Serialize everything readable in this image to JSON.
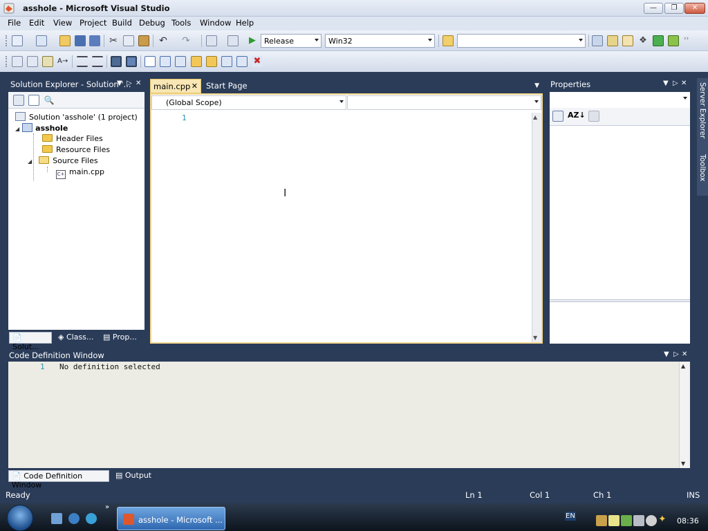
{
  "window": {
    "title": "asshole - Microsoft Visual Studio"
  },
  "menu": [
    "File",
    "Edit",
    "View",
    "Project",
    "Build",
    "Debug",
    "Tools",
    "Window",
    "Help"
  ],
  "toolbar": {
    "config": "Release",
    "platform": "Win32",
    "find_value": ""
  },
  "solution_explorer": {
    "title": "Solution Explorer - Solution '...",
    "solution": "Solution 'asshole' (1 project)",
    "project": "asshole",
    "folders": [
      "Header Files",
      "Resource Files",
      "Source Files"
    ],
    "file": "main.cpp",
    "tabs": [
      "Solut...",
      "Class...",
      "Prop..."
    ]
  },
  "editor": {
    "tabs": [
      "main.cpp",
      "Start Page"
    ],
    "scope": "(Global Scope)",
    "member": "",
    "line_number": "1"
  },
  "properties": {
    "title": "Properties",
    "selector": ""
  },
  "code_definition": {
    "title": "Code Definition Window",
    "line_number": "1",
    "text": "No definition selected",
    "tabs": [
      "Code Definition Window",
      "Output"
    ]
  },
  "side_tabs": [
    "Server Explorer",
    "Toolbox"
  ],
  "status": {
    "ready": "Ready",
    "ln": "Ln 1",
    "col": "Col 1",
    "ch": "Ch 1",
    "ins": "INS"
  },
  "taskbar": {
    "task": "asshole - Microsoft ...",
    "lang": "EN",
    "clock": "08:36"
  }
}
